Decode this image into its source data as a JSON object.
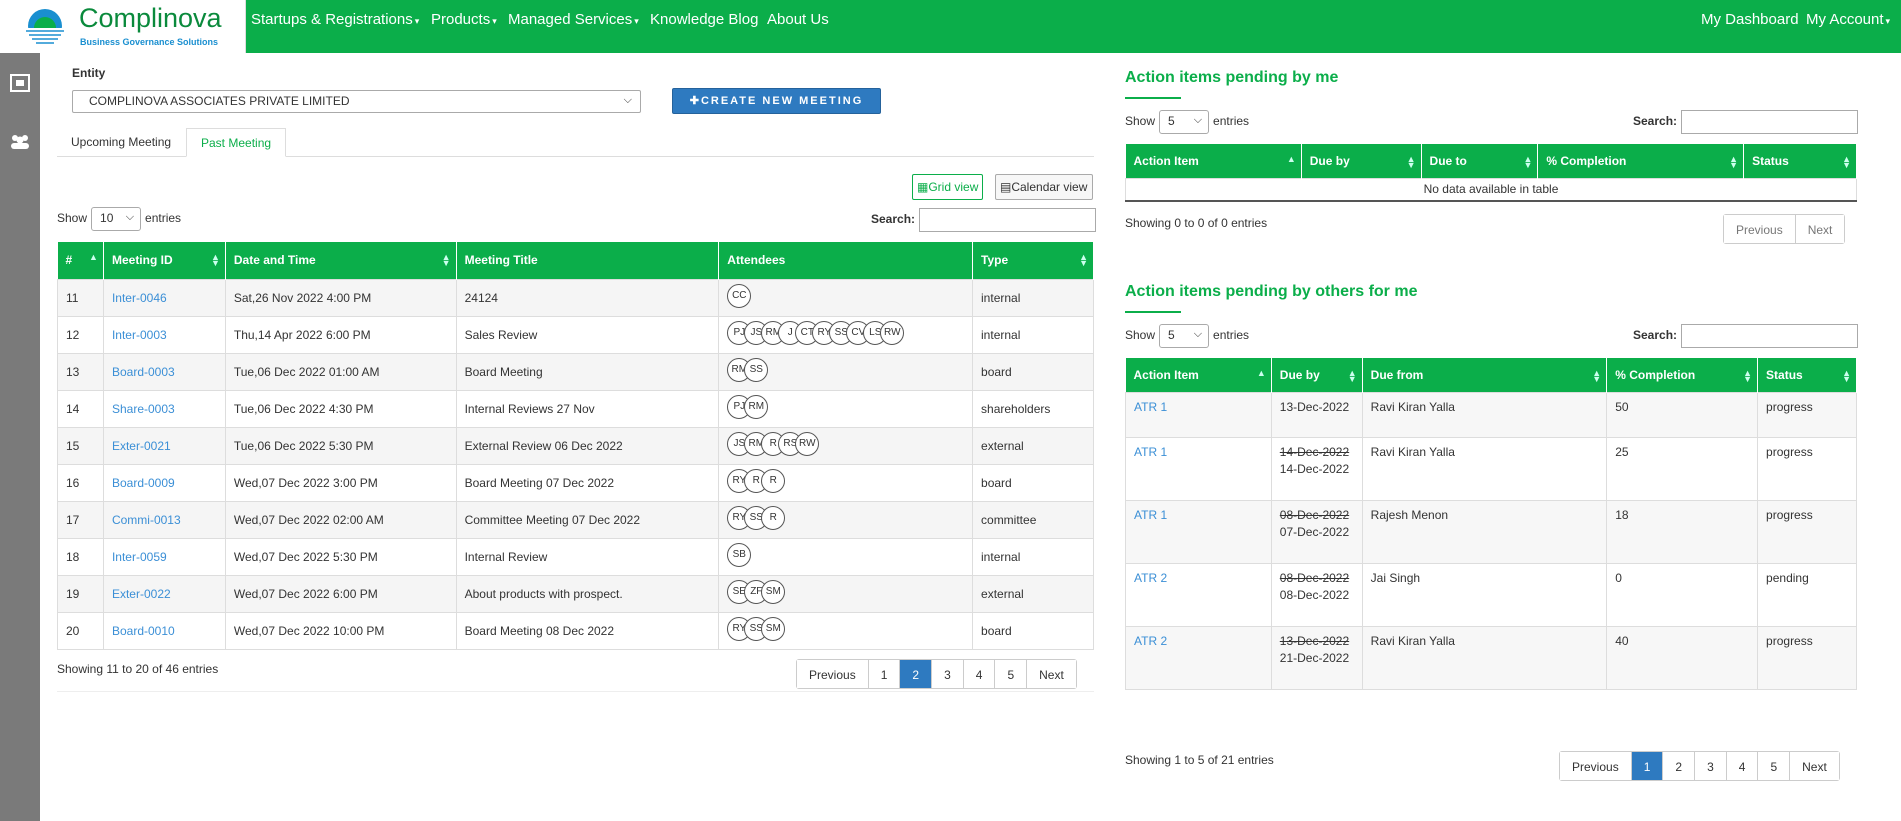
{
  "brand": {
    "name": "Complinova",
    "tagline": "Business Governance Solutions"
  },
  "nav": {
    "items": [
      {
        "label": "Startups & Registrations",
        "dropdown": true
      },
      {
        "label": "Products",
        "dropdown": true
      },
      {
        "label": "Managed Services",
        "dropdown": true
      },
      {
        "label": "Knowledge Blog",
        "dropdown": false
      },
      {
        "label": "About Us",
        "dropdown": false
      }
    ],
    "right": [
      {
        "label": "My Dashboard",
        "dropdown": false
      },
      {
        "label": "My Account",
        "dropdown": true
      }
    ]
  },
  "sidebar": {
    "icons": [
      "meeting-room-icon",
      "users-icon"
    ]
  },
  "entity": {
    "label": "Entity",
    "value": "COMPLINOVA ASSOCIATES PRIVATE LIMITED"
  },
  "create_button": "✚CREATE NEW MEETING",
  "tabs": [
    {
      "label": "Upcoming Meeting",
      "active": false
    },
    {
      "label": "Past Meeting",
      "active": true
    }
  ],
  "views": {
    "grid": "Grid view",
    "calendar": "Calendar view"
  },
  "meetings": {
    "show_label": "Show",
    "show_value": "10",
    "entries_label": "entries",
    "search_label": "Search:",
    "columns": [
      "#",
      "Meeting ID",
      "Date and Time",
      "Meeting Title",
      "Attendees",
      "Type"
    ],
    "rows": [
      {
        "n": "11",
        "id": "Inter-0046",
        "date": "Sat,26 Nov 2022 4:00 PM",
        "title": "24124",
        "attendees": [
          "CC"
        ],
        "type": "internal"
      },
      {
        "n": "12",
        "id": "Inter-0003",
        "date": "Thu,14 Apr 2022 6:00 PM",
        "title": "Sales Review",
        "attendees": [
          "PJ",
          "JS",
          "RM",
          "J",
          "CT",
          "RY",
          "SS",
          "CV",
          "LS",
          "RW"
        ],
        "type": "internal"
      },
      {
        "n": "13",
        "id": "Board-0003",
        "date": "Tue,06 Dec 2022 01:00 AM",
        "title": "Board Meeting",
        "attendees": [
          "RM",
          "SS"
        ],
        "type": "board"
      },
      {
        "n": "14",
        "id": "Share-0003",
        "date": "Tue,06 Dec 2022 4:30 PM",
        "title": "Internal Reviews 27 Nov",
        "attendees": [
          "PJ",
          "RM"
        ],
        "type": "shareholders"
      },
      {
        "n": "15",
        "id": "Exter-0021",
        "date": "Tue,06 Dec 2022 5:30 PM",
        "title": "External Review 06 Dec 2022",
        "attendees": [
          "JS",
          "RM",
          "R",
          "RS",
          "RW"
        ],
        "type": "external"
      },
      {
        "n": "16",
        "id": "Board-0009",
        "date": "Wed,07 Dec 2022 3:00 PM",
        "title": "Board Meeting 07 Dec 2022",
        "attendees": [
          "RY",
          "R",
          "R"
        ],
        "type": "board"
      },
      {
        "n": "17",
        "id": "Commi-0013",
        "date": "Wed,07 Dec 2022 02:00 AM",
        "title": "Committee Meeting 07 Dec 2022",
        "attendees": [
          "RY",
          "SS",
          "R"
        ],
        "type": "committee"
      },
      {
        "n": "18",
        "id": "Inter-0059",
        "date": "Wed,07 Dec 2022 5:30 PM",
        "title": "Internal Review",
        "attendees": [
          "SB"
        ],
        "type": "internal"
      },
      {
        "n": "19",
        "id": "Exter-0022",
        "date": "Wed,07 Dec 2022 6:00 PM",
        "title": "About products with prospect.",
        "attendees": [
          "SE",
          "ZF",
          "SM"
        ],
        "type": "external"
      },
      {
        "n": "20",
        "id": "Board-0010",
        "date": "Wed,07 Dec 2022 10:00 PM",
        "title": "Board Meeting 08 Dec 2022",
        "attendees": [
          "RY",
          "SS",
          "SM"
        ],
        "type": "board"
      }
    ],
    "info": "Showing 11 to 20 of 46 entries",
    "pager": [
      "Previous",
      "1",
      "2",
      "3",
      "4",
      "5",
      "Next"
    ],
    "current_page": "2"
  },
  "pending_by_me": {
    "title": "Action items pending by me",
    "show_label": "Show",
    "show_value": "5",
    "entries_label": "entries",
    "search_label": "Search:",
    "columns": [
      "Action Item",
      "Due by",
      "Due to",
      "% Completion",
      "Status"
    ],
    "empty": "No data available in table",
    "info": "Showing 0 to 0 of 0 entries",
    "pager": [
      "Previous",
      "Next"
    ]
  },
  "pending_by_others": {
    "title": "Action items pending by others for me",
    "show_label": "Show",
    "show_value": "5",
    "entries_label": "entries",
    "search_label": "Search:",
    "columns": [
      "Action Item",
      "Due by",
      "Due from",
      "% Completion",
      "Status"
    ],
    "rows": [
      {
        "item": "ATR 1",
        "old_due": "",
        "due": "13-Dec-2022",
        "from": "Ravi Kiran Yalla",
        "pct": "50",
        "status": "progress"
      },
      {
        "item": "ATR 1",
        "old_due": "14-Dec-2022",
        "due": "14-Dec-2022",
        "from": "Ravi Kiran Yalla",
        "pct": "25",
        "status": "progress"
      },
      {
        "item": "ATR 1",
        "old_due": "08-Dec-2022",
        "due": "07-Dec-2022",
        "from": "Rajesh Menon",
        "pct": "18",
        "status": "progress"
      },
      {
        "item": "ATR 2",
        "old_due": "08-Dec-2022",
        "due": "08-Dec-2022",
        "from": "Jai Singh",
        "pct": "0",
        "status": "pending"
      },
      {
        "item": "ATR 2",
        "old_due": "13-Dec-2022",
        "due": "21-Dec-2022",
        "from": "Ravi Kiran Yalla",
        "pct": "40",
        "status": "progress"
      }
    ],
    "info": "Showing 1 to 5 of 21 entries",
    "pager": [
      "Previous",
      "1",
      "2",
      "3",
      "4",
      "5",
      "Next"
    ],
    "current_page": "1"
  },
  "colors": {
    "brand_green": "#0bae4a",
    "link_blue": "#3b8fd6",
    "primary_blue": "#2e7ac0",
    "sidebar_gray": "#7a7a7a"
  }
}
